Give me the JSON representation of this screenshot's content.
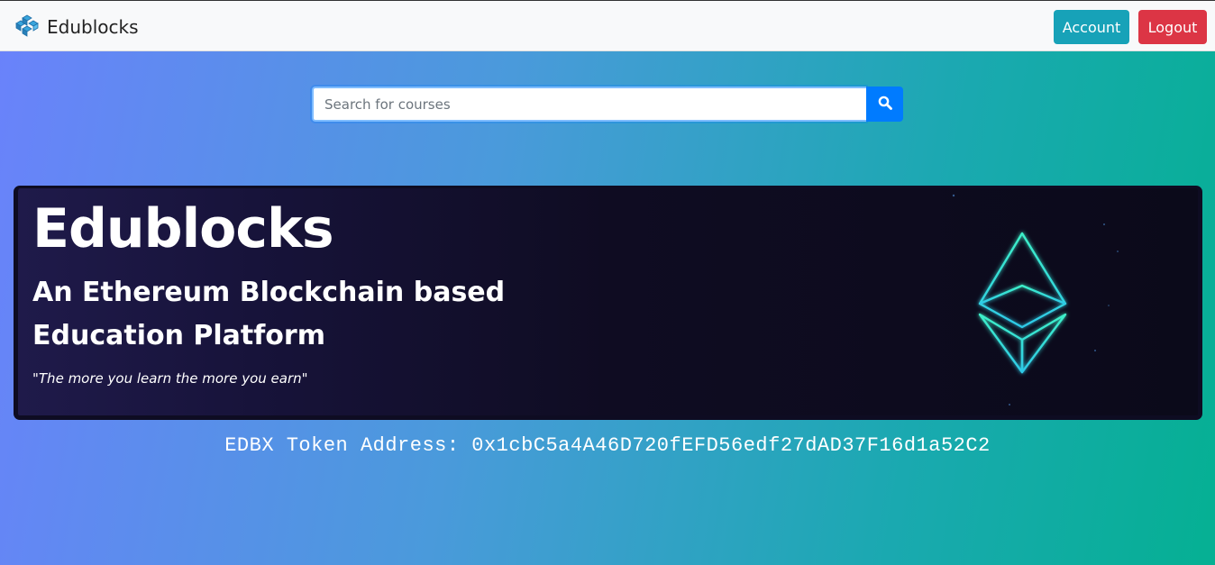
{
  "navbar": {
    "brand": "Edublocks",
    "brand_icon": "blocks-logo-icon",
    "account_label": "Account",
    "logout_label": "Logout",
    "colors": {
      "account": "#17a2b8",
      "logout": "#dc3545"
    }
  },
  "search": {
    "placeholder": "Search for courses",
    "value": "",
    "button_icon": "search-icon",
    "button_color": "#007bff"
  },
  "hero": {
    "title": "Edublocks",
    "subtitle": "An Ethereum Blockchain based Education Platform",
    "quote": "\"The more you learn the more you earn\"",
    "graphic": "ethereum-logo-icon"
  },
  "token": {
    "text": "EDBX Token Address: 0x1cbC5a4A46D720fEFD56edf27dAD37F16d1a52C2"
  }
}
